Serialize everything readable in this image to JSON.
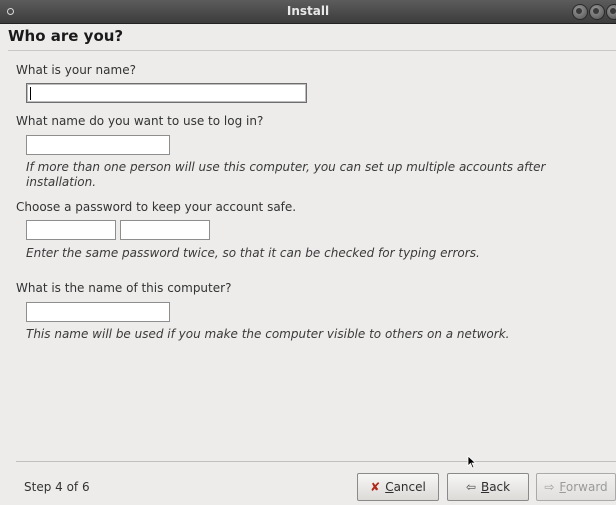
{
  "window": {
    "title": "Install"
  },
  "page": {
    "heading": "Who are you?"
  },
  "form": {
    "name_label": "What is your name?",
    "login_label": "What name do you want to use to log in?",
    "login_hint_line1": "If more than one person will use this computer, you can set up multiple accounts after",
    "login_hint_line2": "installation.",
    "password_label": "Choose a password to keep your account safe.",
    "password_hint": "Enter the same password twice, so that it can be checked for typing errors.",
    "computer_label": "What is the name of this computer?",
    "computer_hint": "This name will be used if you make the computer visible to others on a network.",
    "name_value": "",
    "login_value": "",
    "password_value": "",
    "password_confirm_value": "",
    "computer_value": ""
  },
  "footer": {
    "step": "Step 4 of 6",
    "cancel_mnemonic": "C",
    "cancel_rest": "ancel",
    "back_mnemonic": "B",
    "back_rest": "ack",
    "forward_mnemonic": "F",
    "forward_rest": "orward"
  },
  "icons": {
    "cancel": "x-mark-icon",
    "back": "arrow-left-icon",
    "forward": "arrow-right-icon",
    "pointer": "mouse-pointer-icon"
  },
  "colors": {
    "titlebar": "#4a4a4a",
    "background": "#edeceb",
    "cancel_icon": "#b02a1a"
  }
}
